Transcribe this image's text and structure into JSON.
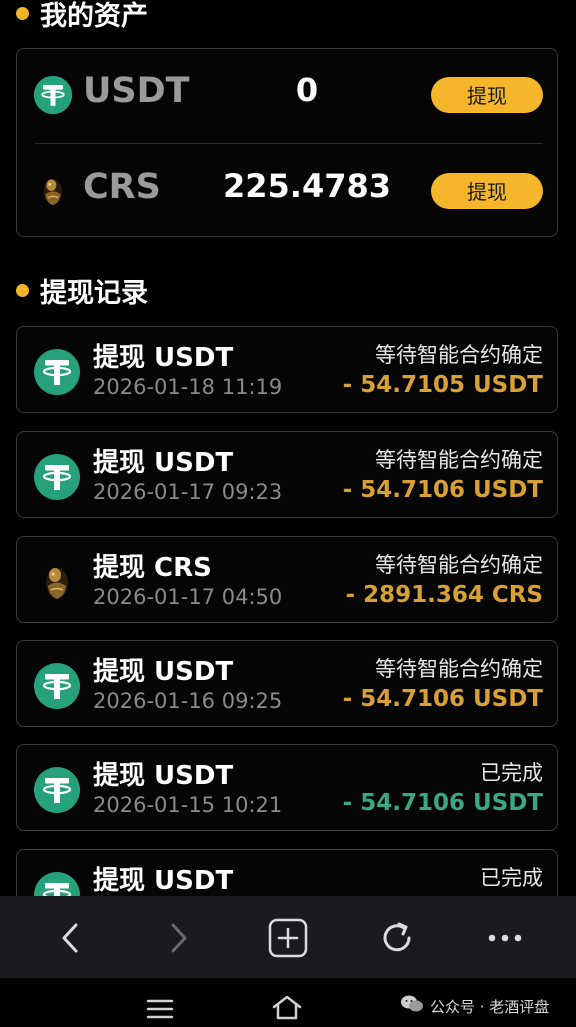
{
  "assets": {
    "title": "我的资产",
    "items": [
      {
        "name": "USDT",
        "balance": "0",
        "button_label": "提现",
        "icon": "tether-icon"
      },
      {
        "name": "CRS",
        "balance": "225.4783",
        "button_label": "提现",
        "icon": "crs-coin-icon"
      }
    ]
  },
  "records": {
    "title": "提现记录",
    "items": [
      {
        "title": "提现 USDT",
        "time": "2026-01-18 11:19",
        "status": "等待智能合约确定",
        "amount": "- 54.7105 USDT",
        "state": "pending",
        "icon": "tether-icon"
      },
      {
        "title": "提现 USDT",
        "time": "2026-01-17 09:23",
        "status": "等待智能合约确定",
        "amount": "- 54.7106 USDT",
        "state": "pending",
        "icon": "tether-icon"
      },
      {
        "title": "提现 CRS",
        "time": "2026-01-17 04:50",
        "status": "等待智能合约确定",
        "amount": "- 2891.364 CRS",
        "state": "pending",
        "icon": "crs-coin-icon"
      },
      {
        "title": "提现 USDT",
        "time": "2026-01-16 09:25",
        "status": "等待智能合约确定",
        "amount": "- 54.7106 USDT",
        "state": "pending",
        "icon": "tether-icon"
      },
      {
        "title": "提现 USDT",
        "time": "2026-01-15 10:21",
        "status": "已完成",
        "amount": "- 54.7106 USDT",
        "state": "done",
        "icon": "tether-icon"
      },
      {
        "title": "提现 USDT",
        "time": "",
        "status": "已完成",
        "amount": "",
        "state": "done",
        "icon": "tether-icon"
      }
    ]
  },
  "browser_nav": {
    "buttons": [
      "back-icon",
      "forward-icon",
      "new-tab-icon",
      "reload-icon",
      "more-icon"
    ]
  },
  "system_nav": {
    "buttons": [
      "menu-icon",
      "home-icon"
    ]
  },
  "watermark": {
    "text": "公众号 · 老酒评盘",
    "icon": "wechat-icon"
  },
  "colors": {
    "accent": "#f5b62c",
    "tether_green": "#26a17b",
    "pending_amount": "#d9a033",
    "done_amount": "#3aa883"
  }
}
